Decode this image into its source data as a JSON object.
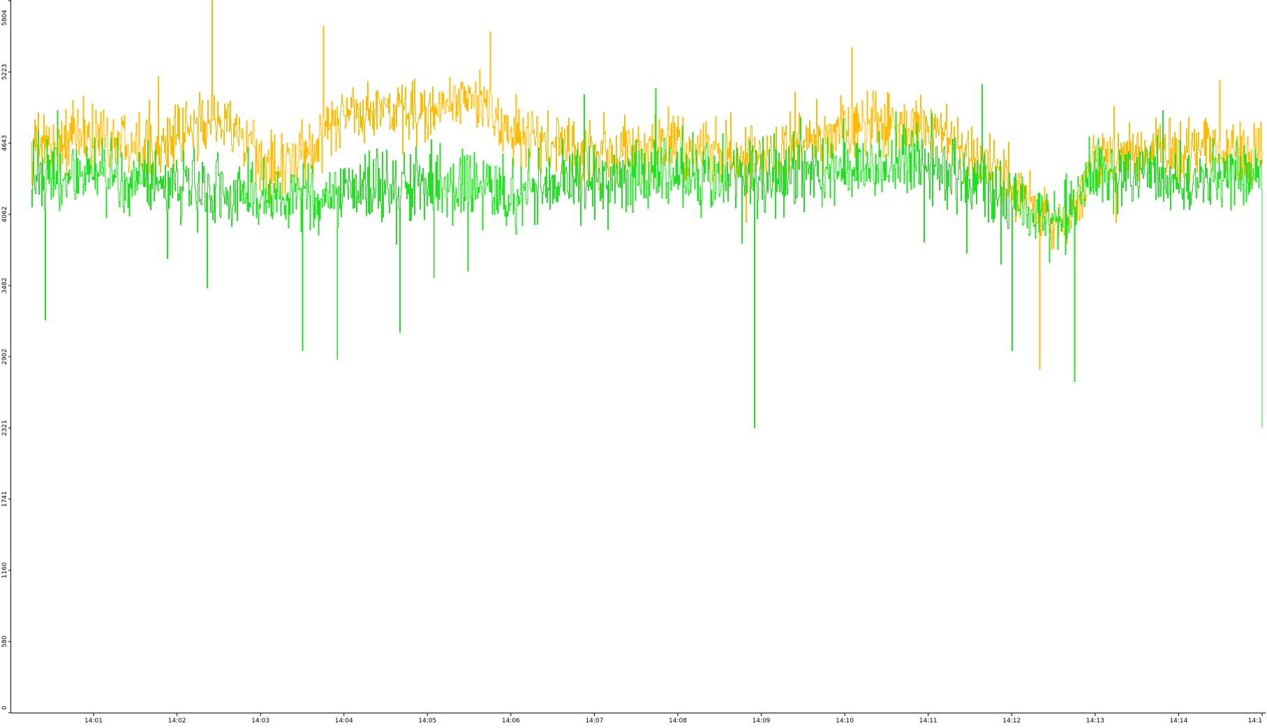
{
  "chart_data": {
    "type": "line",
    "title": "",
    "xlabel": "",
    "ylabel": "",
    "ylim": [
      0,
      5804
    ],
    "y_ticks": [
      "0",
      "580",
      "1160",
      "1741",
      "2321",
      "2902",
      "3482",
      "4062",
      "4643",
      "5223",
      "5804"
    ],
    "x_ticks": [
      "14:01",
      "14:02",
      "14:03",
      "14:04",
      "14:05",
      "14:06",
      "14:07",
      "14:08",
      "14:09",
      "14:10",
      "14:11",
      "14:12",
      "14:13",
      "14:14",
      "14:1"
    ],
    "x_range": [
      "14:00:15",
      "14:15:00"
    ],
    "grid": false,
    "legend": "none",
    "series": [
      {
        "color": "#ffbb00",
        "style": "vertical-spikes",
        "sample_interval_s": 0.5,
        "mean_profile": [
          {
            "time": "14:00:15",
            "value": 4600
          },
          {
            "time": "14:01:00",
            "value": 4700
          },
          {
            "time": "14:02:00",
            "value": 4650
          },
          {
            "time": "14:02:30",
            "value": 4900
          },
          {
            "time": "14:03:00",
            "value": 4450
          },
          {
            "time": "14:03:30",
            "value": 4500
          },
          {
            "time": "14:04:00",
            "value": 4900
          },
          {
            "time": "14:05:00",
            "value": 4900
          },
          {
            "time": "14:05:40",
            "value": 5000
          },
          {
            "time": "14:06:00",
            "value": 4700
          },
          {
            "time": "14:07:00",
            "value": 4550
          },
          {
            "time": "14:08:00",
            "value": 4650
          },
          {
            "time": "14:09:00",
            "value": 4500
          },
          {
            "time": "14:10:00",
            "value": 4750
          },
          {
            "time": "14:11:00",
            "value": 4800
          },
          {
            "time": "14:12:00",
            "value": 4300
          },
          {
            "time": "14:12:40",
            "value": 3900
          },
          {
            "time": "14:13:00",
            "value": 4550
          },
          {
            "time": "14:14:00",
            "value": 4600
          },
          {
            "time": "14:15:00",
            "value": 4550
          }
        ],
        "noise_amplitude": 380,
        "spikes": [
          {
            "time": "14:02:25",
            "value": 5804
          },
          {
            "time": "14:03:45",
            "value": 5600
          },
          {
            "time": "14:05:45",
            "value": 5550
          },
          {
            "time": "14:10:05",
            "value": 5420
          },
          {
            "time": "14:12:20",
            "value": 2800
          },
          {
            "time": "14:12:45",
            "value": 2850
          }
        ]
      },
      {
        "color": "#22e022",
        "style": "vertical-spikes",
        "sample_interval_s": 0.5,
        "mean_profile": [
          {
            "time": "14:00:15",
            "value": 4350
          },
          {
            "time": "14:01:00",
            "value": 4400
          },
          {
            "time": "14:02:00",
            "value": 4300
          },
          {
            "time": "14:03:00",
            "value": 4200
          },
          {
            "time": "14:04:00",
            "value": 4250
          },
          {
            "time": "14:05:00",
            "value": 4300
          },
          {
            "time": "14:06:00",
            "value": 4250
          },
          {
            "time": "14:07:00",
            "value": 4350
          },
          {
            "time": "14:08:00",
            "value": 4400
          },
          {
            "time": "14:09:00",
            "value": 4350
          },
          {
            "time": "14:10:00",
            "value": 4450
          },
          {
            "time": "14:11:00",
            "value": 4500
          },
          {
            "time": "14:12:00",
            "value": 4150
          },
          {
            "time": "14:12:40",
            "value": 4000
          },
          {
            "time": "14:13:00",
            "value": 4450
          },
          {
            "time": "14:14:00",
            "value": 4350
          },
          {
            "time": "14:15:00",
            "value": 4400
          }
        ],
        "noise_amplitude": 420,
        "spikes": [
          {
            "time": "14:00:25",
            "value": 3200
          },
          {
            "time": "14:03:30",
            "value": 2950
          },
          {
            "time": "14:03:55",
            "value": 2880
          },
          {
            "time": "14:04:40",
            "value": 3100
          },
          {
            "time": "14:08:55",
            "value": 2321
          },
          {
            "time": "14:12:00",
            "value": 2950
          },
          {
            "time": "14:12:45",
            "value": 2700
          },
          {
            "time": "14:15:00",
            "value": 2321
          }
        ]
      }
    ]
  }
}
